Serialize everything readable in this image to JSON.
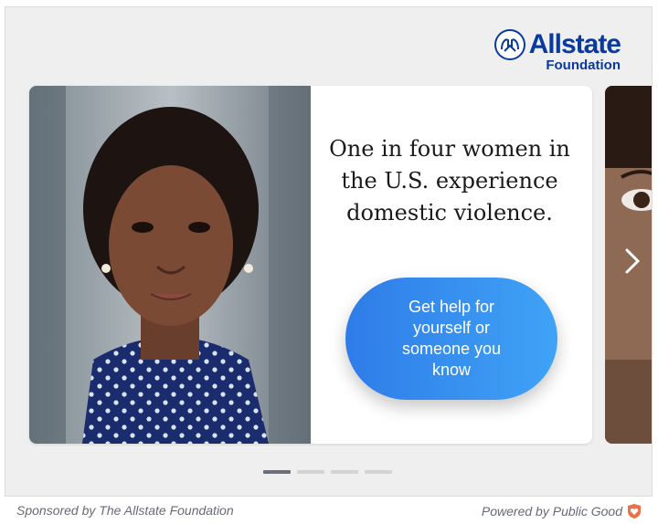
{
  "brand": {
    "name": "Allstate",
    "sub": "Foundation",
    "color": "#0a3a9e",
    "icon": "hands-logo-icon"
  },
  "slide": {
    "headline": "One in four women in the U.S. experience domestic violence.",
    "cta_label": "Get help for yourself or someone you know",
    "cta_colors": [
      "#2f7ce8",
      "#3fa3f6"
    ],
    "photo": "portrait-photo"
  },
  "carousel": {
    "total_slides": 4,
    "active_slide": 1,
    "next_icon": "chevron-right-icon"
  },
  "footer": {
    "sponsor": "Sponsored by The Allstate Foundation",
    "powered": "Powered by Public Good",
    "powered_icon": "heart-shield-icon"
  }
}
